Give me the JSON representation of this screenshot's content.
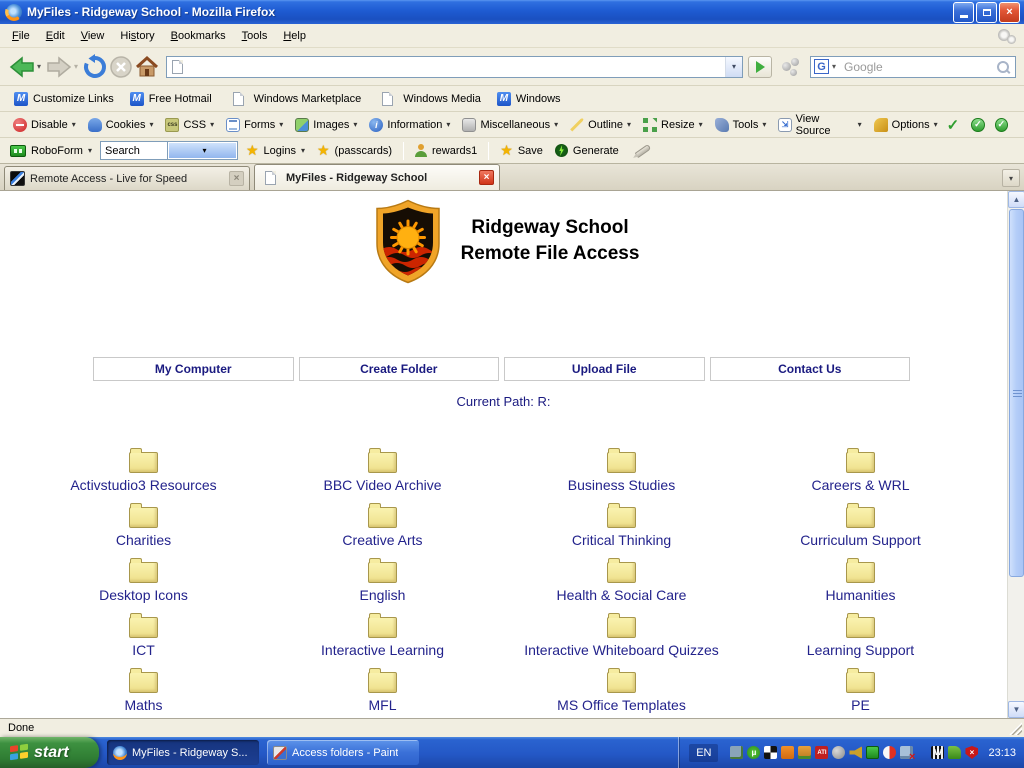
{
  "window": {
    "title": "MyFiles - Ridgeway School - Mozilla Firefox"
  },
  "menu": {
    "items": [
      {
        "pre": "",
        "key": "F",
        "post": "ile"
      },
      {
        "pre": "",
        "key": "E",
        "post": "dit"
      },
      {
        "pre": "",
        "key": "V",
        "post": "iew"
      },
      {
        "pre": "Hi",
        "key": "s",
        "post": "tory"
      },
      {
        "pre": "",
        "key": "B",
        "post": "ookmarks"
      },
      {
        "pre": "",
        "key": "T",
        "post": "ools"
      },
      {
        "pre": "",
        "key": "H",
        "post": "elp"
      }
    ]
  },
  "navigation": {
    "address_value": "",
    "search_placeholder": "Google"
  },
  "bookmarks_toolbar": {
    "items": [
      {
        "label": "Customize Links",
        "icon": "msn-icon"
      },
      {
        "label": "Free Hotmail",
        "icon": "msn-icon"
      },
      {
        "label": "Windows Marketplace",
        "icon": "page-icon"
      },
      {
        "label": "Windows Media",
        "icon": "page-icon"
      },
      {
        "label": "Windows",
        "icon": "msn-icon"
      }
    ]
  },
  "webdev_toolbar": {
    "items": [
      "Disable",
      "Cookies",
      "CSS",
      "Forms",
      "Images",
      "Information",
      "Miscellaneous",
      "Outline",
      "Resize",
      "Tools",
      "View Source",
      "Options"
    ],
    "status_colors": {
      "check_green": "#2f9e2f"
    }
  },
  "roboform_toolbar": {
    "app_label": "RoboForm",
    "search_value": "Search",
    "logins_label": "Logins",
    "passcards_label": "(passcards)",
    "rewards_label": "rewards1",
    "save_label": "Save",
    "generate_label": "Generate"
  },
  "tabs": [
    {
      "title": "Remote Access - Live for Speed",
      "active": false
    },
    {
      "title": "MyFiles - Ridgeway School",
      "active": true
    }
  ],
  "page": {
    "site_title_line1": "Ridgeway School",
    "site_title_line2": "Remote File Access",
    "nav_buttons": [
      "My Computer",
      "Create Folder",
      "Upload File",
      "Contact Us"
    ],
    "current_path_label": "Current Path: R:",
    "link_color": "#23238c",
    "folders": [
      "Activstudio3 Resources",
      "BBC Video Archive",
      "Business Studies",
      "Careers & WRL",
      "Charities",
      "Creative Arts",
      "Critical Thinking",
      "Curriculum Support",
      "Desktop Icons",
      "English",
      "Health & Social Care",
      "Humanities",
      "ICT",
      "Interactive Learning",
      "Interactive Whiteboard Quizzes",
      "Learning Support",
      "Maths",
      "MFL",
      "MS Office Templates",
      "PE"
    ]
  },
  "statusbar": {
    "text": "Done"
  },
  "taskbar": {
    "start_label": "start",
    "tasks": [
      {
        "title": "MyFiles - Ridgeway S...",
        "icon": "firefox-icon",
        "state": "active"
      },
      {
        "title": "Access folders - Paint",
        "icon": "paint-icon",
        "state": "normal"
      }
    ],
    "language_indicator": "EN",
    "clock": "23:13",
    "tray_icons": [
      "display-signal",
      "utorrent",
      "checkerboard",
      "java",
      "java-update",
      "ati",
      "globe",
      "volume",
      "roboform",
      "flash",
      "network-offline",
      "watchguard",
      "system-tool",
      "security-alert"
    ],
    "colors": {
      "taskbar_blue": "#2458c6",
      "start_green": "#3d9140"
    }
  }
}
